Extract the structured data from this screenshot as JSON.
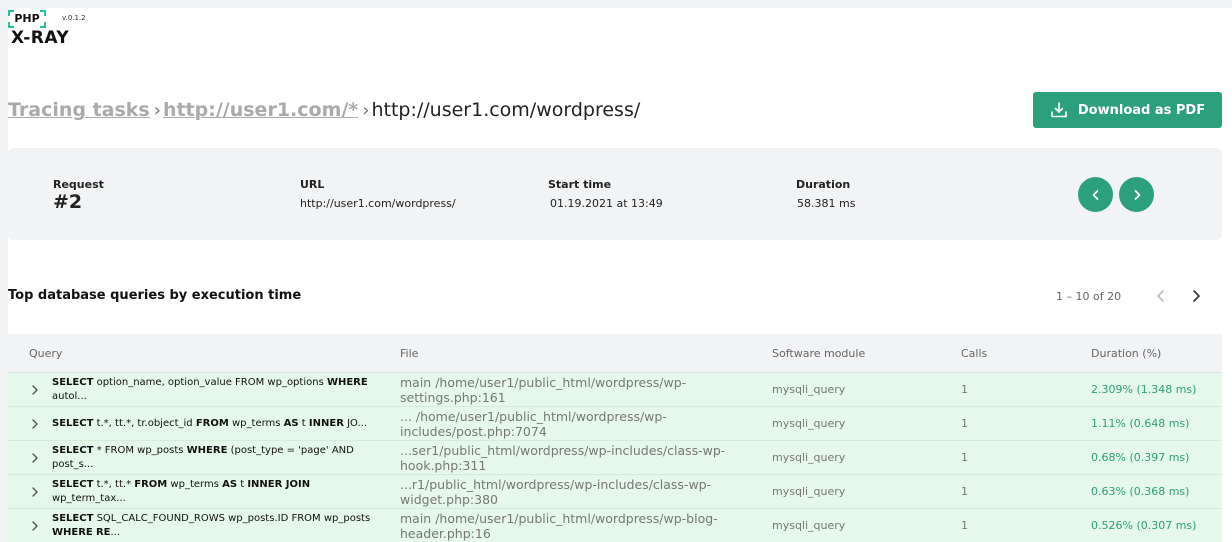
{
  "logo": {
    "php": "PHP",
    "xray": "X-RAY",
    "version": "v.0.1.2"
  },
  "breadcrumb": {
    "items": [
      "Tracing tasks",
      "http://user1.com/*"
    ],
    "current": "http://user1.com/wordpress/"
  },
  "actions": {
    "download_label": "Download as PDF"
  },
  "request": {
    "labels": {
      "request": "Request",
      "url": "URL",
      "start_time": "Start time",
      "duration": "Duration"
    },
    "number": "#2",
    "url": "http://user1.com/wordpress/",
    "start_time": "01.19.2021 at 13:49",
    "duration": "58.381 ms"
  },
  "section": {
    "title": "Top database queries by execution time",
    "pager": "1 – 10 of 20"
  },
  "table": {
    "columns": [
      "Query",
      "File",
      "Software module",
      "Calls",
      "Duration (%)"
    ],
    "rows": [
      {
        "query": [
          [
            "k",
            "SELECT"
          ],
          [
            "t",
            " option_name, option_value FROM wp_options "
          ],
          [
            "k",
            "WHERE"
          ],
          [
            "t",
            " autol..."
          ]
        ],
        "file": "main /home/user1/public_html/wordpress/wp-settings.php:161",
        "module": "mysqli_query",
        "calls": "1",
        "duration": "2.309% (1.348 ms)"
      },
      {
        "query": [
          [
            "k",
            "SELECT"
          ],
          [
            "t",
            "  t.*, tt.*, tr.object_id "
          ],
          [
            "k",
            "FROM"
          ],
          [
            "t",
            " wp_terms "
          ],
          [
            "k",
            "AS"
          ],
          [
            "t",
            " t  "
          ],
          [
            "k",
            "INNER"
          ],
          [
            "t",
            " JO..."
          ]
        ],
        "file": "... /home/user1/public_html/wordpress/wp-includes/post.php:7074",
        "module": "mysqli_query",
        "calls": "1",
        "duration": "1.11% (0.648 ms)"
      },
      {
        "query": [
          [
            "k",
            "SELECT"
          ],
          [
            "t",
            " * FROM wp_posts  "
          ],
          [
            "k",
            "WHERE"
          ],
          [
            "t",
            " (post_type = 'page' AND post_s..."
          ]
        ],
        "file": "...ser1/public_html/wordpress/wp-includes/class-wp-hook.php:311",
        "module": "mysqli_query",
        "calls": "1",
        "duration": "0.68% (0.397 ms)"
      },
      {
        "query": [
          [
            "k",
            "SELECT"
          ],
          [
            "t",
            "  t.*, tt.* "
          ],
          [
            "k",
            "FROM"
          ],
          [
            "t",
            " wp_terms "
          ],
          [
            "k",
            "AS"
          ],
          [
            "t",
            " t  "
          ],
          [
            "k",
            "INNER JOIN"
          ],
          [
            "t",
            " wp_term_tax..."
          ]
        ],
        "file": "...r1/public_html/wordpress/wp-includes/class-wp-widget.php:380",
        "module": "mysqli_query",
        "calls": "1",
        "duration": "0.63% (0.368 ms)"
      },
      {
        "query": [
          [
            "k",
            "SELECT"
          ],
          [
            "t",
            " SQL_CALC_FOUND_ROWS  wp_posts.ID FROM wp_posts  "
          ],
          [
            "k",
            "WHERE"
          ],
          [
            "t",
            " "
          ],
          [
            "k",
            "RE"
          ],
          [
            "t",
            "..."
          ]
        ],
        "file": "main /home/user1/public_html/wordpress/wp-blog-header.php:16",
        "module": "mysqli_query",
        "calls": "1",
        "duration": "0.526% (0.307 ms)"
      }
    ]
  },
  "colors": {
    "accent": "#2c9f7c",
    "row_bg": "#e6f8e9",
    "logo_bracket": "#28c0a0"
  }
}
